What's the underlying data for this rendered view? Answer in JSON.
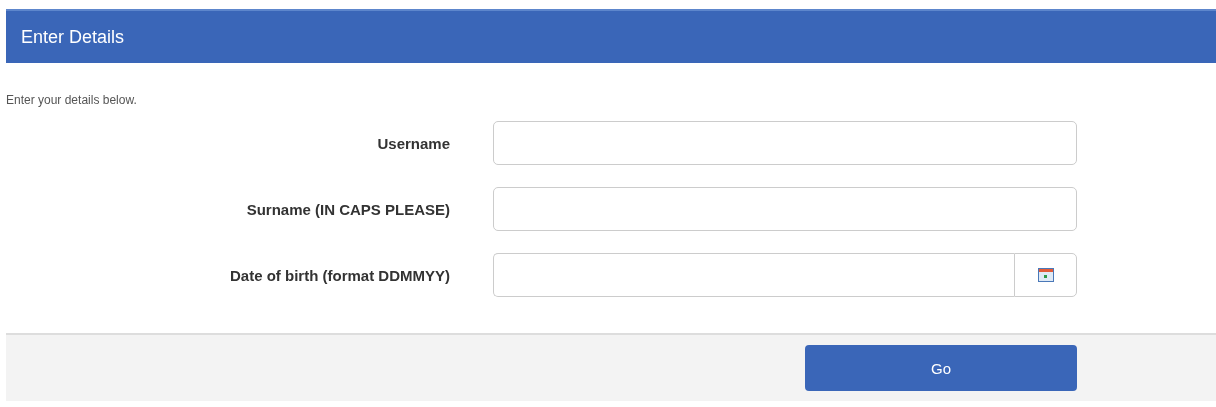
{
  "panel": {
    "title": "Enter Details"
  },
  "intro": "Enter your details below.",
  "fields": [
    {
      "label": "Username",
      "kind": "text"
    },
    {
      "label": "Surname (IN CAPS PLEASE)",
      "kind": "text"
    },
    {
      "label": "Date of birth (format DDMMYY)",
      "kind": "date"
    }
  ],
  "buttons": [
    "Go"
  ]
}
